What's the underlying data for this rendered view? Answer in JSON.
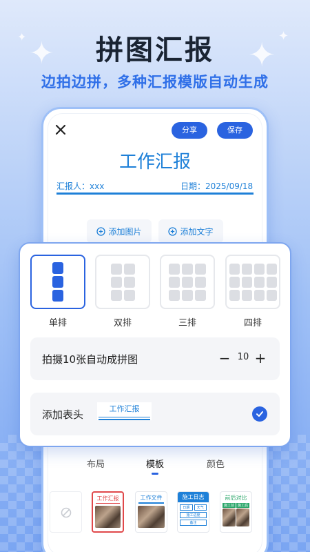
{
  "headline": "拼图汇报",
  "subline": "边拍边拼，多种汇报模版自动生成",
  "editor": {
    "share_label": "分享",
    "save_label": "保存",
    "doc_title": "工作汇报",
    "reporter": "汇报人：xxx",
    "date": "日期：2025/09/18",
    "add_image": "添加图片",
    "add_text": "添加文字"
  },
  "layouts": [
    {
      "label": "单排",
      "selected": true
    },
    {
      "label": "双排",
      "selected": false
    },
    {
      "label": "三排",
      "selected": false
    },
    {
      "label": "四排",
      "selected": false
    }
  ],
  "auto_collage": {
    "label": "拍摄10张自动成拼图",
    "count": "10",
    "minus": "−",
    "plus": "+"
  },
  "header_option": {
    "label": "添加表头",
    "tag": "工作汇报",
    "checked": true
  },
  "tabs": [
    {
      "label": "布局",
      "active": false
    },
    {
      "label": "模板",
      "active": true
    },
    {
      "label": "颜色",
      "active": false
    }
  ],
  "templates": [
    {
      "title": "",
      "icon": "none-icon"
    },
    {
      "title": "工作汇报",
      "selected": true
    },
    {
      "title": "工作文件"
    },
    {
      "title": "施工日志",
      "fields": [
        "日期",
        "天气",
        "施工进度",
        "备注"
      ]
    },
    {
      "title": "前后对比",
      "fields": [
        "施工前",
        "施工后"
      ]
    }
  ],
  "colors": {
    "accent": "#2a63e0",
    "doc_blue": "#1e80d8",
    "headline": "#1a2433",
    "template_red": "#e0484a",
    "template_green": "#2aa66a"
  }
}
